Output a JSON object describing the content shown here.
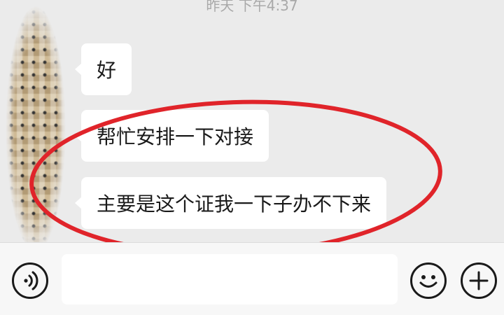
{
  "chat": {
    "timestamp": "昨天 下午4:37",
    "messages": [
      {
        "text": "好"
      },
      {
        "text": "帮忙安排一下对接"
      },
      {
        "text": "主要是这个证我一下子办不下来"
      }
    ]
  },
  "input_bar": {
    "message_input_value": "",
    "icons": [
      "voice-icon",
      "emoji-icon",
      "plus-icon"
    ]
  },
  "colors": {
    "chat_background": "#ebebeb",
    "bubble": "#ffffff",
    "annotation": "#e0242a"
  }
}
